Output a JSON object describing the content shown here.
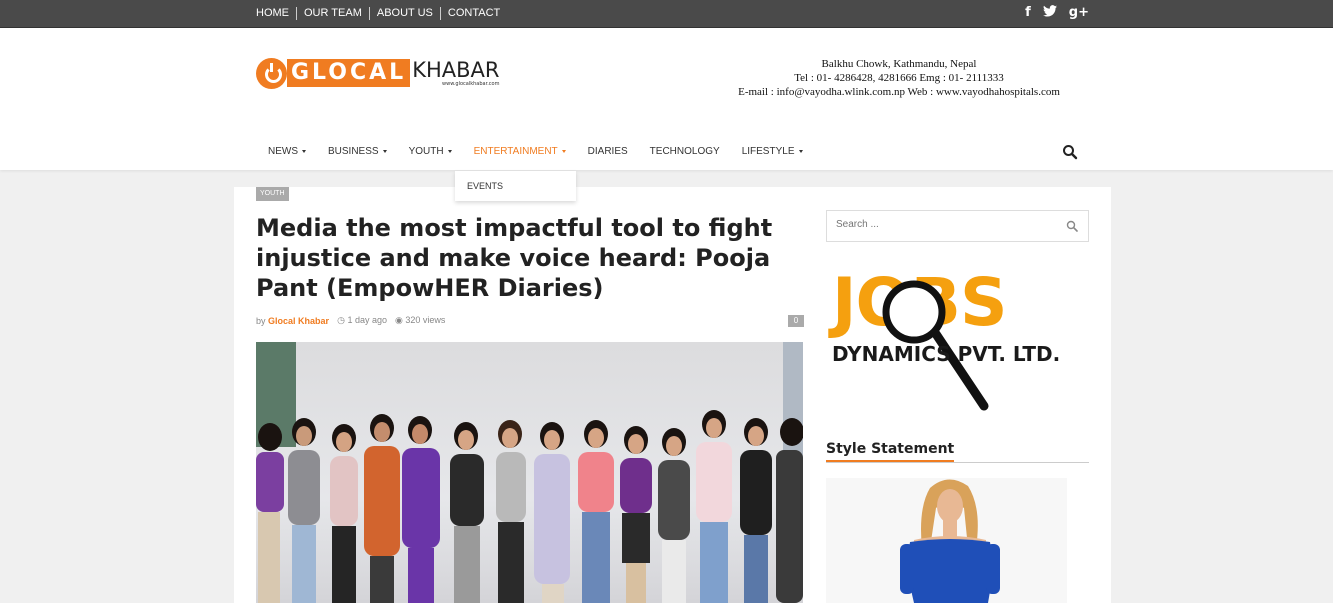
{
  "topnav": {
    "items": [
      "HOME",
      "OUR TEAM",
      "ABOUT US",
      "CONTACT"
    ]
  },
  "social": {
    "facebook": "f",
    "twitter": "𝕥",
    "googleplus": "g+"
  },
  "logo": {
    "glocal": "GLOCAL",
    "khabar": "KHABAR",
    "url": "www.glocalkhabar.com"
  },
  "hospital": {
    "line1": "Balkhu Chowk, Kathmandu, Nepal",
    "line2": "Tel : 01- 4286428, 4281666 Emg : 01- 2111333",
    "line3": "E-mail : info@vayodha.wlink.com.np Web : www.vayodhahospitals.com"
  },
  "mainnav": {
    "items": [
      "NEWS",
      "BUSINESS",
      "YOUTH",
      "ENTERTAINMENT",
      "DIARIES",
      "TECHNOLOGY",
      "LIFESTYLE"
    ],
    "dropdown_item": "EVENTS"
  },
  "article": {
    "category": "YOUTH",
    "title": "Media the most impactful tool to fight injustice and make voice heard: Pooja Pant (EmpowHER Diaries)",
    "by": "by",
    "author": "Glocal Khabar",
    "time": "1 day ago",
    "views": "320 views",
    "comments": "0"
  },
  "sidebar": {
    "search_placeholder": "Search ...",
    "ad_jobs": "JOBS",
    "ad_company": "DYNAMICS PVT. LTD.",
    "widget_title": "Style Statement"
  },
  "colors": {
    "accent": "#f07c21",
    "topbar": "#4a4a4a",
    "jobs_orange": "#f5a00f"
  }
}
